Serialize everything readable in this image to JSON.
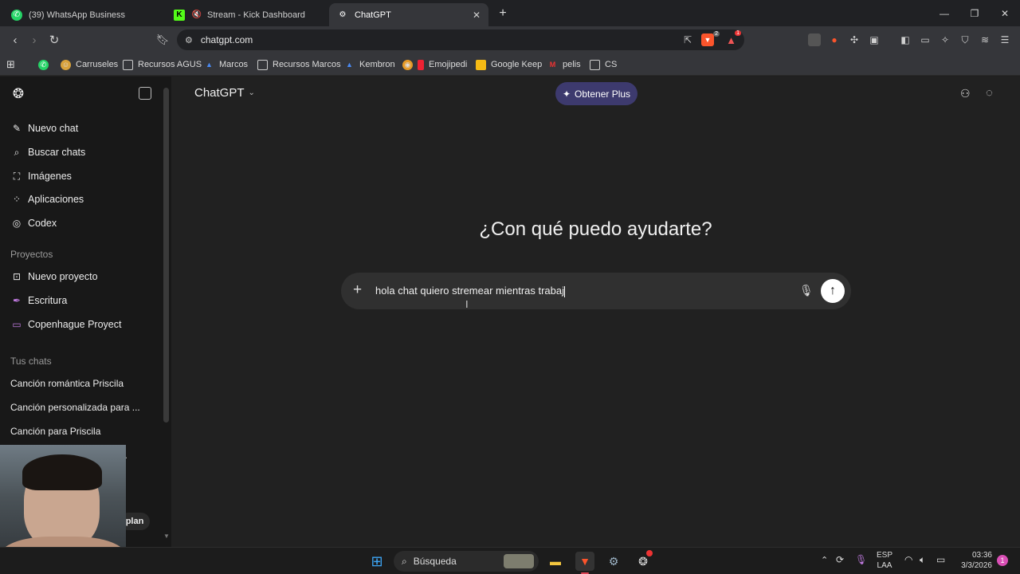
{
  "browser": {
    "tabs": [
      {
        "title": "(39) WhatsApp Business"
      },
      {
        "title": "Stream - Kick Dashboard"
      },
      {
        "title": "ChatGPT"
      }
    ],
    "url": "chatgpt.com",
    "bookmarks": [
      {
        "label": "Carruseles"
      },
      {
        "label": "Recursos AGUS"
      },
      {
        "label": "Marcos"
      },
      {
        "label": "Recursos Marcos"
      },
      {
        "label": "Kembron"
      },
      {
        "label": "Emojipedi"
      },
      {
        "label": "Google Keep"
      },
      {
        "label": "pelis"
      },
      {
        "label": "CS"
      }
    ],
    "shield_badge": "2",
    "rewards_badge": "1"
  },
  "sidebar": {
    "nav": [
      {
        "label": "Nuevo chat",
        "icon": "edit-icon"
      },
      {
        "label": "Buscar chats",
        "icon": "search-icon"
      },
      {
        "label": "Imágenes",
        "icon": "image-icon"
      },
      {
        "label": "Aplicaciones",
        "icon": "apps-icon"
      },
      {
        "label": "Codex",
        "icon": "codex-icon"
      }
    ],
    "projects_header": "Proyectos",
    "projects": [
      {
        "label": "Nuevo proyecto"
      },
      {
        "label": "Escritura"
      },
      {
        "label": "Copenhague Proyect"
      }
    ],
    "chats_header": "Tus chats",
    "chats": [
      {
        "label": "Canción romántica Priscila"
      },
      {
        "label": "Canción personalizada para ..."
      },
      {
        "label": "Canción para Priscila"
      }
    ],
    "upgrade_label": "plan"
  },
  "main": {
    "model_title": "ChatGPT",
    "plus_button": "Obtener Plus",
    "headline": "¿Con qué puedo ayudarte?",
    "composer_text": "hola chat quiero stremear mientras trabaj"
  },
  "taskbar": {
    "search_label": "Búsqueda",
    "lang_top": "ESP",
    "lang_bottom": "LAA",
    "time": "03:36",
    "date": "3/3/2026",
    "notification_count": "1"
  },
  "colors": {
    "accent_plus": "#3d3a6e",
    "brave_orange": "#fb542b",
    "whatsapp_green": "#25d366",
    "kick_green": "#53fc18"
  }
}
